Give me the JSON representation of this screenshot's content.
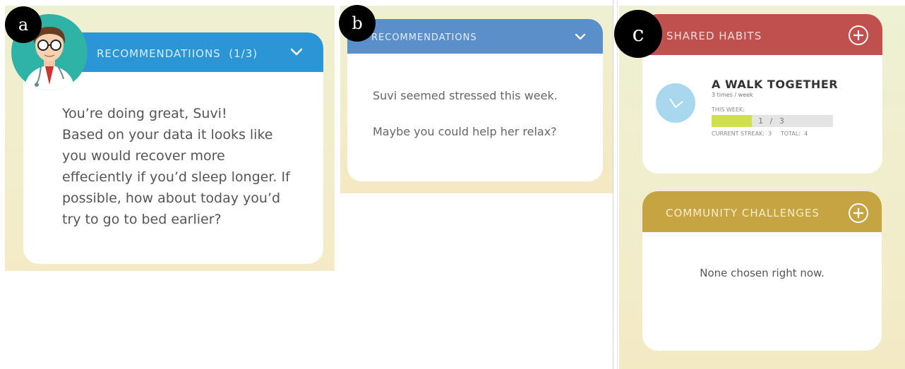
{
  "panel_a": {
    "badge": "a",
    "header_title": "RECOMMENDATIIONS  (1/3)",
    "icon": "chevron-down-icon",
    "avatar": "doctor-avatar",
    "message_lines": [
      "You’re doing great, Suvi!",
      "Based on your data it looks like",
      "you would recover more",
      "effeciently if you’d sleep longer. If",
      "possible, how about today you’d",
      "try to go to bed earlier?"
    ],
    "colors": {
      "header": "#2b95d6",
      "avatar_bg": "#2fb3a6"
    }
  },
  "panel_b": {
    "badge": "b",
    "header_title": "RECOMMENDATIONS",
    "icon": "chevron-down-icon",
    "line1": "Suvi seemed stressed this week.",
    "line2": "Maybe you could help her relax?",
    "colors": {
      "header": "#5b8fc9"
    }
  },
  "panel_c": {
    "badge": "c",
    "shared_habits": {
      "title": "SHARED HABITS",
      "icon": "plus-circle-icon",
      "habit": {
        "name": "A WALK TOGETHER",
        "frequency": "3 times / week",
        "this_week_label": "THIS WEEK:",
        "progress_text": "1 / 3",
        "progress_fraction": 0.333,
        "streak_text": "CURRENT STREAK:  3     TOTAL:  4",
        "icon": "clock-icon"
      },
      "colors": {
        "header": "#c0504e",
        "progress": "#cfe04a"
      }
    },
    "community_challenges": {
      "title": "COMMUNITY CHALLENGES",
      "icon": "plus-circle-icon",
      "empty_text": "None chosen right now.",
      "colors": {
        "header": "#c6a442"
      }
    }
  }
}
